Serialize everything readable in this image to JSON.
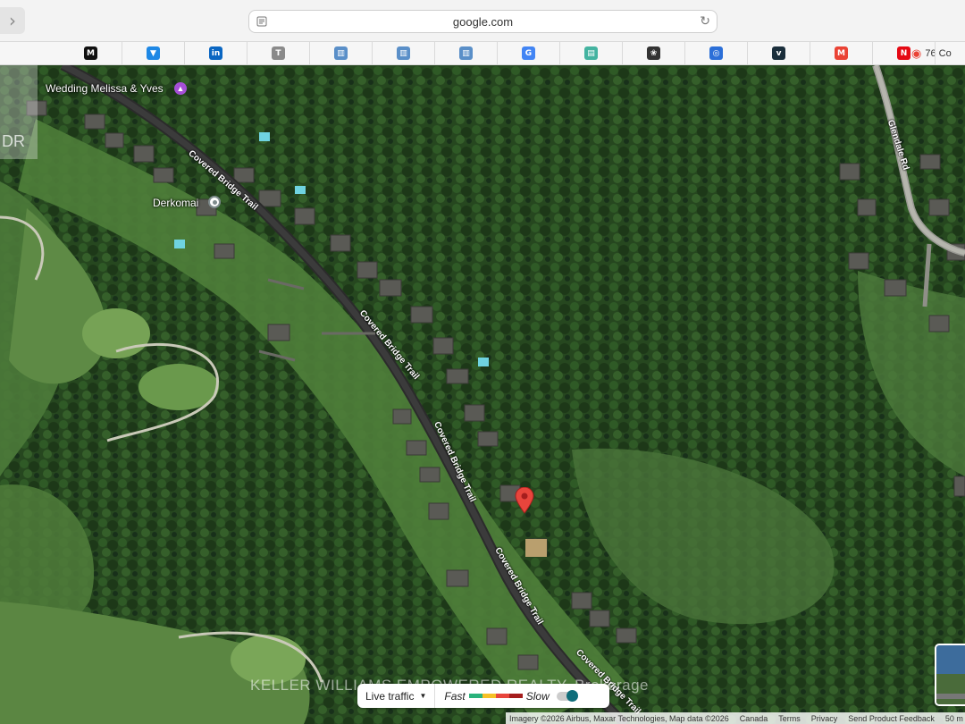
{
  "browser": {
    "url": "google.com",
    "back_glyph": "›",
    "reload_glyph": "↻"
  },
  "bookmarks": [
    {
      "icon": "medium-icon",
      "glyph": "M",
      "color": "#111111"
    },
    {
      "icon": "vivaldi-v-icon",
      "glyph": "▼",
      "color": "#1e88e5"
    },
    {
      "icon": "linkedin-icon",
      "glyph": "in",
      "color": "#0a66c2"
    },
    {
      "icon": "t-icon",
      "glyph": "T",
      "color": "#8a8a8a"
    },
    {
      "icon": "building-icon",
      "glyph": "▥",
      "color": "#5a8fc8"
    },
    {
      "icon": "building-icon",
      "glyph": "▥",
      "color": "#5a8fc8"
    },
    {
      "icon": "building-icon",
      "glyph": "▥",
      "color": "#5a8fc8"
    },
    {
      "icon": "google-icon",
      "glyph": "G",
      "color": "#4285f4"
    },
    {
      "icon": "tower-icon",
      "glyph": "▤",
      "color": "#44b3a0"
    },
    {
      "icon": "openai-icon",
      "glyph": "❀",
      "color": "#333333"
    },
    {
      "icon": "circle-logo-icon",
      "glyph": "◎",
      "color": "#2b6fd8"
    },
    {
      "icon": "vimeo-icon",
      "glyph": "v",
      "color": "#1a2e3b"
    },
    {
      "icon": "gmail-icon",
      "glyph": "M",
      "color": "#ea4335"
    },
    {
      "icon": "netflix-icon",
      "glyph": "N",
      "color": "#e50914"
    }
  ],
  "last_bookmark": {
    "icon": "maps-pin-icon",
    "label": "76 Co"
  },
  "map": {
    "places": [
      {
        "label": "Wedding Melissa & Yves",
        "icon": "venue-icon",
        "color": "#a64fd6"
      },
      {
        "label": "Derkomai",
        "icon": "place-icon",
        "color": "#7f8c8d"
      }
    ],
    "roads": [
      {
        "label": "Covered Bridge Trail"
      },
      {
        "label": "Covered Bridge Trail"
      },
      {
        "label": "Covered Bridge Trail"
      },
      {
        "label": "Covered Bridge Trail"
      },
      {
        "label": "Covered Bridge Trail"
      },
      {
        "label": "Glendale Rd"
      }
    ],
    "watermark": "KELLER WILLIAMS EMPOWERED REALTY, Brokerage",
    "side_text": "DR"
  },
  "traffic": {
    "live_label": "Live traffic",
    "fast_label": "Fast",
    "slow_label": "Slow",
    "colors": [
      "#2ab27b",
      "#f6c026",
      "#e8453c",
      "#a51d1d"
    ]
  },
  "attribution": {
    "imagery": "Imagery ©2026 Airbus, Maxar Technologies, Map data ©2026",
    "country": "Canada",
    "terms": "Terms",
    "privacy": "Privacy",
    "feedback": "Send Product Feedback",
    "scale": "50 m"
  }
}
